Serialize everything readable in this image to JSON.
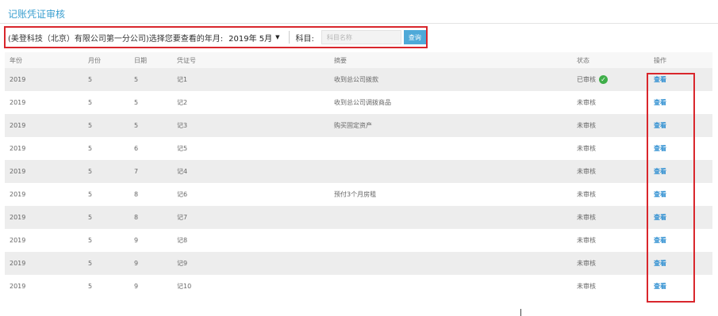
{
  "page": {
    "title": "记账凭证审核"
  },
  "filter": {
    "prompt": "(美登科技（北京）有限公司第一分公司)选择您要查看的年月:",
    "period_value": "2019年 5月",
    "subject_label": "科目:",
    "subject_placeholder": "科目名称",
    "query_label": "查询"
  },
  "table": {
    "headers": [
      "年份",
      "月份",
      "日期",
      "凭证号",
      "摘要",
      "状态",
      "操作"
    ],
    "rows": [
      {
        "year": "2019",
        "month": "5",
        "day": "5",
        "voucher": "记1",
        "summary": "收到总公司拨款",
        "status": "已审核",
        "approved": true,
        "action": "查看"
      },
      {
        "year": "2019",
        "month": "5",
        "day": "5",
        "voucher": "记2",
        "summary": "收到总公司调拨商品",
        "status": "未审核",
        "approved": false,
        "action": "查看"
      },
      {
        "year": "2019",
        "month": "5",
        "day": "5",
        "voucher": "记3",
        "summary": "购买固定资产",
        "status": "未审核",
        "approved": false,
        "action": "查看"
      },
      {
        "year": "2019",
        "month": "5",
        "day": "6",
        "voucher": "记5",
        "summary": "",
        "status": "未审核",
        "approved": false,
        "action": "查看"
      },
      {
        "year": "2019",
        "month": "5",
        "day": "7",
        "voucher": "记4",
        "summary": "",
        "status": "未审核",
        "approved": false,
        "action": "查看"
      },
      {
        "year": "2019",
        "month": "5",
        "day": "8",
        "voucher": "记6",
        "summary": "预付3个月房租",
        "status": "未审核",
        "approved": false,
        "action": "查看"
      },
      {
        "year": "2019",
        "month": "5",
        "day": "8",
        "voucher": "记7",
        "summary": "",
        "status": "未审核",
        "approved": false,
        "action": "查看"
      },
      {
        "year": "2019",
        "month": "5",
        "day": "9",
        "voucher": "记8",
        "summary": "",
        "status": "未审核",
        "approved": false,
        "action": "查看"
      },
      {
        "year": "2019",
        "month": "5",
        "day": "9",
        "voucher": "记9",
        "summary": "",
        "status": "未审核",
        "approved": false,
        "action": "查看"
      },
      {
        "year": "2019",
        "month": "5",
        "day": "9",
        "voucher": "记10",
        "summary": "",
        "status": "未审核",
        "approved": false,
        "action": "查看"
      }
    ]
  },
  "colors": {
    "accent": "#3a9fd0",
    "highlight_border": "#d9262c",
    "approved_icon": "#3fae49",
    "link": "#2f8fd1"
  },
  "icons": {
    "approved": "check-circle-icon",
    "select_caret": "caret-down-icon"
  }
}
